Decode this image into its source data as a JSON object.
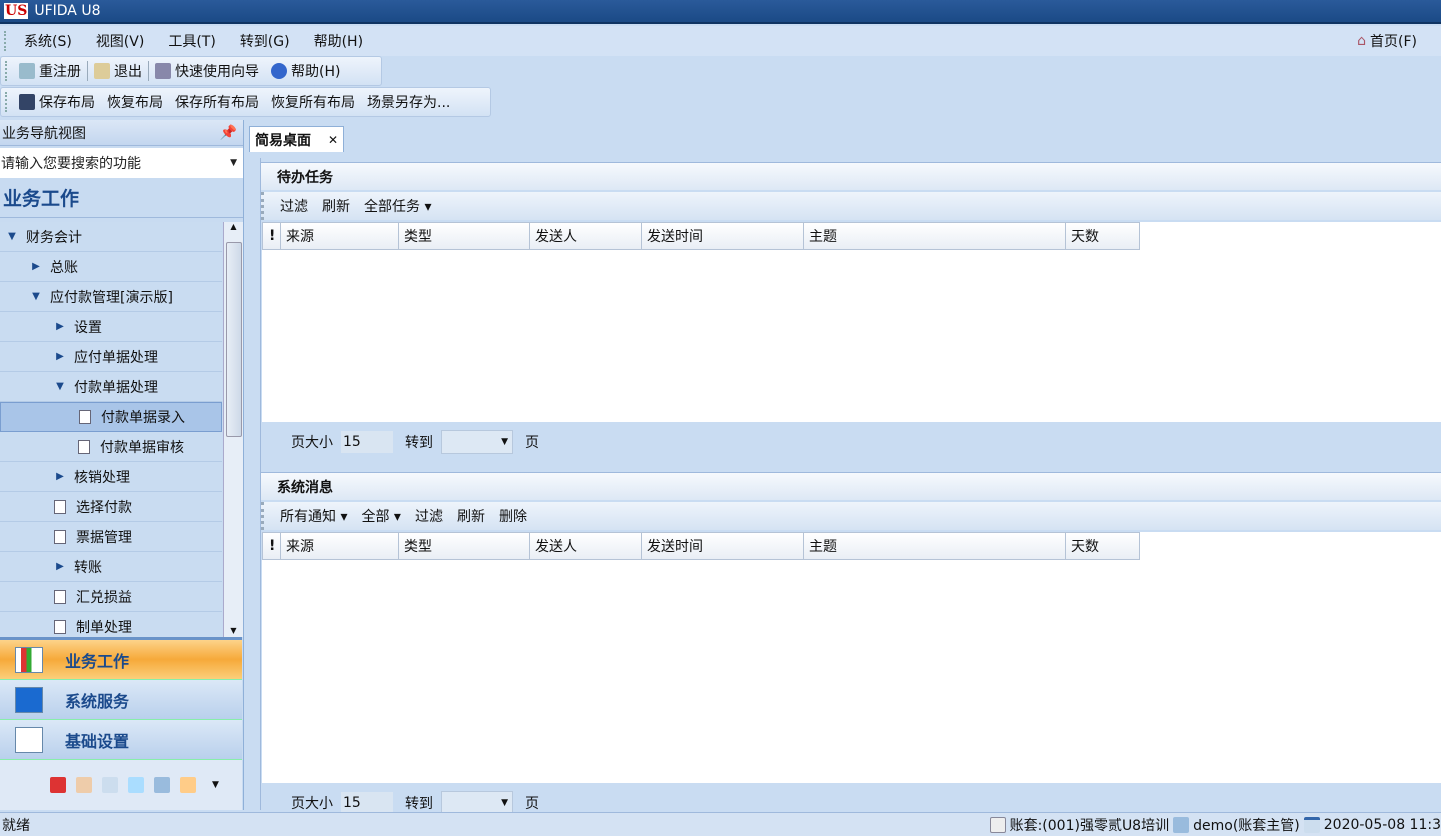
{
  "window": {
    "title": "UFIDA U8",
    "logo": "US"
  },
  "menu": [
    "系统(S)",
    "视图(V)",
    "工具(T)",
    "转到(G)",
    "帮助(H)"
  ],
  "home": "首页(F)",
  "toolbar1": [
    "重注册",
    "退出",
    "快速使用向导",
    "帮助(H)"
  ],
  "toolbar2": [
    "保存布局",
    "恢复布局",
    "保存所有布局",
    "恢复所有布局",
    "场景另存为..."
  ],
  "nav": {
    "header": "业务导航视图",
    "pin": "ᵖ",
    "search_placeholder": "请输入您要搜索的功能",
    "section": "业务工作",
    "tree": [
      {
        "label": "财务会计",
        "level": 0,
        "arrow": "down"
      },
      {
        "label": "总账",
        "level": 1,
        "arrow": "right"
      },
      {
        "label": "应付款管理[演示版]",
        "level": 1,
        "arrow": "down"
      },
      {
        "label": "设置",
        "level": 2,
        "arrow": "right"
      },
      {
        "label": "应付单据处理",
        "level": 2,
        "arrow": "right"
      },
      {
        "label": "付款单据处理",
        "level": 2,
        "arrow": "down"
      },
      {
        "label": "付款单据录入",
        "level": 3,
        "doc": true,
        "selected": true
      },
      {
        "label": "付款单据审核",
        "level": 3,
        "doc": true
      },
      {
        "label": "核销处理",
        "level": 2,
        "arrow": "right"
      },
      {
        "label": "选择付款",
        "level": 2,
        "doc": true
      },
      {
        "label": "票据管理",
        "level": 2,
        "doc": true
      },
      {
        "label": "转账",
        "level": 2,
        "arrow": "right"
      },
      {
        "label": "汇兑损益",
        "level": 2,
        "doc": true
      },
      {
        "label": "制单处理",
        "level": 2,
        "doc": true
      }
    ],
    "buttons": [
      "业务工作",
      "系统服务",
      "基础设置"
    ]
  },
  "tab": {
    "label": "简易桌面",
    "close": "✕"
  },
  "todo": {
    "title": "待办任务",
    "tools": [
      "过滤",
      "刷新",
      "全部任务 ▾"
    ],
    "columns": [
      "!",
      "来源",
      "类型",
      "发送人",
      "发送时间",
      "主题",
      "天数"
    ],
    "page_size_label": "页大小",
    "page_size": "15",
    "goto": "转到",
    "page": "页"
  },
  "messages": {
    "title": "系统消息",
    "tools": [
      "所有通知 ▾",
      "全部 ▾",
      "过滤",
      "刷新",
      "删除"
    ],
    "columns": [
      "!",
      "来源",
      "类型",
      "发送人",
      "发送时间",
      "主题",
      "天数"
    ],
    "page_size_label": "页大小",
    "page_size": "15",
    "goto": "转到",
    "page": "页"
  },
  "status": {
    "left": "就绪",
    "account": "账套:(001)强零贰U8培训",
    "user": "demo(账套主管)",
    "datetime": "2020-05-08 11:3"
  }
}
